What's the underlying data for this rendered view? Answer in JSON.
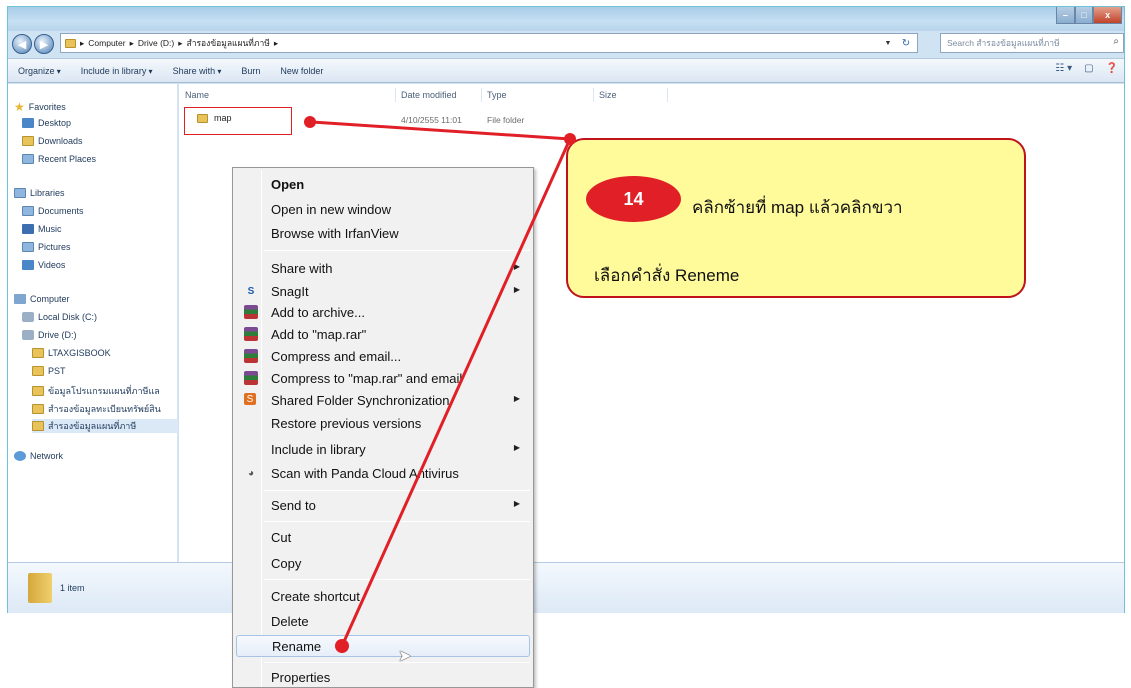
{
  "window": {
    "controls": {
      "minimize": "–",
      "maximize": "□",
      "close": "x"
    },
    "back_icon": "back-arrow-icon",
    "forward_icon": "forward-arrow-icon"
  },
  "address": {
    "segments": [
      "Computer",
      "Drive (D:)",
      "สำรองข้อมูลแผนที่ภาษี"
    ],
    "separator": "▸"
  },
  "search": {
    "placeholder": "Search สำรองข้อมูลแผนที่ภาษี"
  },
  "toolbar": {
    "organize": "Organize",
    "include_in_library": "Include in library",
    "share_with": "Share with",
    "burn": "Burn",
    "new_folder": "New folder"
  },
  "sidebar": {
    "favorites": "Favorites",
    "desktop": "Desktop",
    "downloads": "Downloads",
    "recent_places": "Recent Places",
    "libraries": "Libraries",
    "documents": "Documents",
    "music": "Music",
    "pictures": "Pictures",
    "videos": "Videos",
    "computer": "Computer",
    "local_disk": "Local Disk (C:)",
    "drive_d": "Drive (D:)",
    "ltaxgisbook": "LTAXGISBOOK",
    "pst": "PST",
    "folder_a": "ข้อมูลโปรแกรมแผนที่ภาษีแล",
    "folder_b": "สำรองข้อมูลทะเบียนทรัพย์สิน",
    "folder_c": "สำรองข้อมูลแผนที่ภาษี",
    "network": "Network"
  },
  "columns": {
    "name": "Name",
    "date_modified": "Date modified",
    "type": "Type",
    "size": "Size"
  },
  "files": [
    {
      "name": "map",
      "date_modified": "4/10/2555 11:01",
      "type": "File folder",
      "size": ""
    }
  ],
  "status": {
    "item_count": "1 item"
  },
  "context_menu": {
    "open": "Open",
    "open_new_window": "Open in new window",
    "browse_irfanview": "Browse with IrfanView",
    "share_with": "Share with",
    "snagit": "SnagIt",
    "add_to_archive": "Add to archive...",
    "add_to_map_rar": "Add to \"map.rar\"",
    "compress_email": "Compress and email...",
    "compress_map_email": "Compress to \"map.rar\" and email",
    "shared_folder_sync": "Shared Folder Synchronization",
    "restore_versions": "Restore previous versions",
    "include_in_library": "Include in library",
    "scan_panda": "Scan with Panda Cloud Antivirus",
    "send_to": "Send to",
    "cut": "Cut",
    "copy": "Copy",
    "create_shortcut": "Create shortcut",
    "delete": "Delete",
    "rename": "Rename",
    "properties": "Properties"
  },
  "callout": {
    "step": "14",
    "line1": "คลิกซ้ายที่ map แล้วคลิกขวา",
    "line2": "เลือกคำสั่ง Reneme",
    "color": "#e11f26",
    "bg": "#fffa9a"
  }
}
